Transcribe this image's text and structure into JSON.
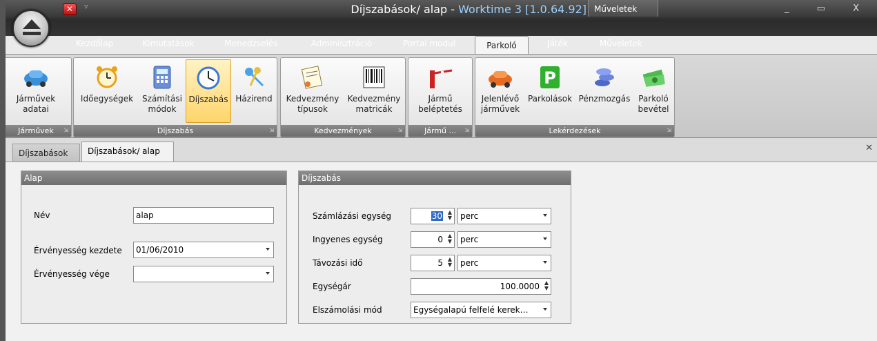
{
  "window": {
    "title_prefix": "Díjszabások/ alap - ",
    "title_app": "Worktime 3 [1.0.64.92]",
    "context_tab": "Műveletek",
    "controls": "_ ▭ X"
  },
  "qat": {
    "close_glyph": "✕",
    "arrow_glyph": "▿"
  },
  "ribbon_tabs": [
    {
      "label": "Kezdőlap"
    },
    {
      "label": "Kimutatások"
    },
    {
      "label": "Menedzselés"
    },
    {
      "label": "Adminisztráció"
    },
    {
      "label": "Portai modul"
    },
    {
      "label": "Parkoló"
    },
    {
      "label": "Játék"
    },
    {
      "label": "Műveletek"
    }
  ],
  "ribbon_groups": [
    {
      "label": "Járművek",
      "buttons": [
        {
          "label": "Járművek\nadatai",
          "icon": "car-icon"
        }
      ]
    },
    {
      "label": "Díjszabás",
      "buttons": [
        {
          "label": "Időegységek",
          "icon": "alarm-clock-icon"
        },
        {
          "label": "Számítási\nmódok",
          "icon": "calculator-icon"
        },
        {
          "label": "Díjszabás",
          "icon": "clock-icon",
          "selected": true
        },
        {
          "label": "Házirend",
          "icon": "keys-icon"
        }
      ]
    },
    {
      "label": "Kedvezmények",
      "buttons": [
        {
          "label": "Kedvezmény\ntípusok",
          "icon": "certificate-icon"
        },
        {
          "label": "Kedvezmény\nmatricák",
          "icon": "barcode-icon"
        }
      ]
    },
    {
      "label": "Jármű ...",
      "buttons": [
        {
          "label": "Jármű\nbeléptetés",
          "icon": "barrier-icon"
        }
      ]
    },
    {
      "label": "Lekérdezések",
      "buttons": [
        {
          "label": "Jelenlévő\njárművek",
          "icon": "orange-car-icon"
        },
        {
          "label": "Parkolások",
          "icon": "parking-sign-icon"
        },
        {
          "label": "Pénzmozgás",
          "icon": "coins-icon"
        },
        {
          "label": "Parkoló\nbevétel",
          "icon": "money-icon"
        }
      ]
    }
  ],
  "doc_tabs": [
    {
      "label": "Díjszabások"
    },
    {
      "label": "Díjszabások/ alap"
    }
  ],
  "alap": {
    "header": "Alap",
    "nev_label": "Név",
    "nev_value": "alap",
    "kezdete_label": "Érvényesség kezdete",
    "kezdete_value": "01/06/2010",
    "vege_label": "Érvényesség vége",
    "vege_value": ""
  },
  "dijszabas": {
    "header": "Díjszabás",
    "szamlazasi_label": "Számlázási egység",
    "szamlazasi_value": "30",
    "szamlazasi_unit": "perc",
    "ingyenes_label": "Ingyenes egység",
    "ingyenes_value": "0",
    "ingyenes_unit": "perc",
    "tavozasi_label": "Távozási idő",
    "tavozasi_value": "5",
    "tavozasi_unit": "perc",
    "egysegar_label": "Egységár",
    "egysegar_value": "100.0000",
    "elszamolasi_label": "Elszámolási mód",
    "elszamolasi_value": "Egységalapú felfelé kerek…"
  }
}
